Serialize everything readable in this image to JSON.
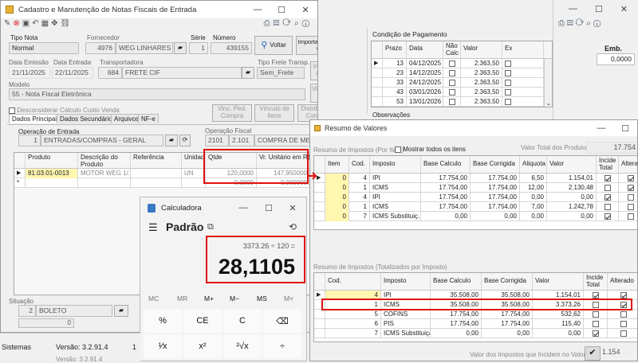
{
  "main": {
    "title": "Cadastro e Manutenção de Notas Fiscais de Entrada",
    "labels": {
      "tipo_nota": "Tipo Nota",
      "fornecedor": "Fornecedor",
      "serie": "Série",
      "numero": "Número",
      "data_emissao": "Data Emissão",
      "data_entrada": "Data Entrada",
      "transportadora": "Transportadora",
      "tipo_frete": "Tipo Frete Transp.",
      "modelo": "Modelo",
      "desconsiderar": "Desconsiderar Cálculo Custo Venda",
      "operacao_entrada": "Operação de Entrada",
      "operacao_fiscal": "Operação Fiscal",
      "situacao": "Situação"
    },
    "values": {
      "tipo_nota": "Normal",
      "fornecedor_cod": "4976",
      "fornecedor_nome": "WEG LINHARES",
      "serie": "1",
      "numero": "439155",
      "data_emissao": "21/11/2025",
      "data_entrada": "22/11/2025",
      "transp_cod": "684",
      "transp_nome": "FRETE CIF",
      "tipo_frete": "Sem_Frete",
      "modelo": "55 - Nota Fiscal Eletrônica",
      "op_entrada_cod": "1",
      "op_entrada_nome": "ENTRADAS/COMPRAS - GERAL",
      "op_fiscal_1": "2101",
      "op_fiscal_2": "2.101",
      "op_fiscal_nome": "COMPRA DE ME",
      "situacao_cod": "2",
      "situacao_nome": "BOLETO",
      "bottom_value": "0"
    },
    "buttons": {
      "voltar": "Voltar",
      "importar": "Importar NF-e/CT-e (Xml)",
      "imp_pedido": "Imp Pedido/ Consultas",
      "vincular": "Vincular Pré-Recebim",
      "vinc_ped": "Vinc. Ped. Compra",
      "vinculo_itens": "Vínculo de Itens",
      "distribuicao": "Distribuição Contábil"
    },
    "tabs": [
      "Dados Principais",
      "Dados Secundários",
      "Arquivos",
      "NF-e"
    ],
    "items_headers": [
      "Produto",
      "Descrição do Produto",
      "Referência",
      "Unidade",
      "Qtde",
      "Vr. Unitário em R$"
    ],
    "items_rows": [
      {
        "produto": "81.03.01-0013",
        "descricao": "MOTOR WEG 1/...",
        "referencia": "",
        "unidade": "UN",
        "qtde": "120,0000",
        "vr_unitario": "147,95000000"
      },
      {
        "produto": "",
        "descricao": "",
        "referencia": "",
        "unidade": "",
        "qtde": "0,0000",
        "vr_unitario": "0,00000000"
      }
    ],
    "condicao": {
      "title": "Condição de Pagamento",
      "headers": [
        "Prazo",
        "Data",
        "Não Calc",
        "Valor",
        "Ex"
      ],
      "rows": [
        {
          "prazo": "13",
          "data": "04/12/2025",
          "valor": "2.363,50"
        },
        {
          "prazo": "23",
          "data": "14/12/2025",
          "valor": "2.363,50"
        },
        {
          "prazo": "33",
          "data": "24/12/2025",
          "valor": "2.363,50"
        },
        {
          "prazo": "43",
          "data": "03/01/2026",
          "valor": "2.363,50"
        },
        {
          "prazo": "53",
          "data": "13/01/2026",
          "valor": "2.363,50"
        }
      ],
      "observacoes": "Observações"
    },
    "emb_label": "Emb.",
    "emb_value": "0,0000"
  },
  "resumo": {
    "title": "Resumo de Valores",
    "impostos_por_item": "Resumo de Impostos (Por Item)",
    "mostrar_todos": "Mostrar todos os itens",
    "valor_total_label": "Valor Total dos Produtos",
    "valor_total": "17.754",
    "headers1": [
      "Item",
      "Cod.",
      "Imposto",
      "Base Calculo",
      "Base Corrigida",
      "Aliquota",
      "Valor",
      "Incide Total",
      "Alterado"
    ],
    "rows1": [
      {
        "item": "0",
        "cod": "4",
        "imposto": "IPI",
        "base": "17.754,00",
        "corrigida": "17.754,00",
        "aliquota": "6,50",
        "valor": "1.154,01",
        "incide": true,
        "alterado": true
      },
      {
        "item": "0",
        "cod": "1",
        "imposto": "ICMS",
        "base": "17.754,00",
        "corrigida": "17.754,00",
        "aliquota": "12,00",
        "valor": "2.130,48",
        "incide": false,
        "alterado": true
      },
      {
        "item": "0",
        "cod": "4",
        "imposto": "IPI",
        "base": "17.754,00",
        "corrigida": "17.754,00",
        "aliquota": "0,00",
        "valor": "0,00",
        "incide": true,
        "alterado": false
      },
      {
        "item": "0",
        "cod": "1",
        "imposto": "ICMS",
        "base": "17.754,00",
        "corrigida": "17.754,00",
        "aliquota": "7,00",
        "valor": "1.242,78",
        "incide": false,
        "alterado": false
      },
      {
        "item": "0",
        "cod": "7",
        "imposto": "ICMS Substituiç...",
        "base": "0,00",
        "corrigida": "0,00",
        "aliquota": "0,00",
        "valor": "0,00",
        "incide": true,
        "alterado": false
      }
    ],
    "impostos_totalizados": "Resumo de Impostos (Totalizados por Imposto)",
    "headers2": [
      "Cod.",
      "Imposto",
      "Base Calculo",
      "Base Corrigida",
      "Valor",
      "Incide Total",
      "Alterado"
    ],
    "rows2": [
      {
        "cod": "4",
        "imposto": "IPI",
        "base": "35.508,00",
        "corrigida": "35.508,00",
        "valor": "1.154,01",
        "incide": true,
        "alterado": true
      },
      {
        "cod": "1",
        "imposto": "ICMS",
        "base": "35.508,00",
        "corrigida": "35.508,00",
        "valor": "3.373,26",
        "incide": false,
        "alterado": true
      },
      {
        "cod": "5",
        "imposto": "COFINS",
        "base": "17.754,00",
        "corrigida": "17.754,00",
        "valor": "532,62",
        "incide": false,
        "alterado": false
      },
      {
        "cod": "6",
        "imposto": "PIS",
        "base": "17.754,00",
        "corrigida": "17.754,00",
        "valor": "115,40",
        "incide": false,
        "alterado": false
      },
      {
        "cod": "7",
        "imposto": "ICMS Substituiçã...",
        "base": "0,00",
        "corrigida": "0,00",
        "valor": "0,00",
        "incide": true,
        "alterado": false
      }
    ],
    "footer_label": "Valor dos Impostos que Incidem no Valor Total",
    "footer_value": "1.154"
  },
  "calc": {
    "title": "Calculadora",
    "mode": "Padrão",
    "expression": "3373.26 ÷ 120 =",
    "result": "28,1105",
    "memory": [
      "MC",
      "MR",
      "M+",
      "M−",
      "MS",
      "M˅"
    ],
    "keys": [
      "%",
      "CE",
      "C",
      "⌫",
      "¹⁄x",
      "x²",
      "²√x",
      "÷"
    ]
  },
  "status": {
    "sistemas": "Sistemas",
    "versao": "Versão: 3.2.91.4",
    "one": "1",
    "versao2": "Versão: 3.2.91.4"
  },
  "colors": {
    "highlight": "#e01010",
    "accent": "#1a5fb4",
    "row_yellow": "#fff6b0"
  }
}
